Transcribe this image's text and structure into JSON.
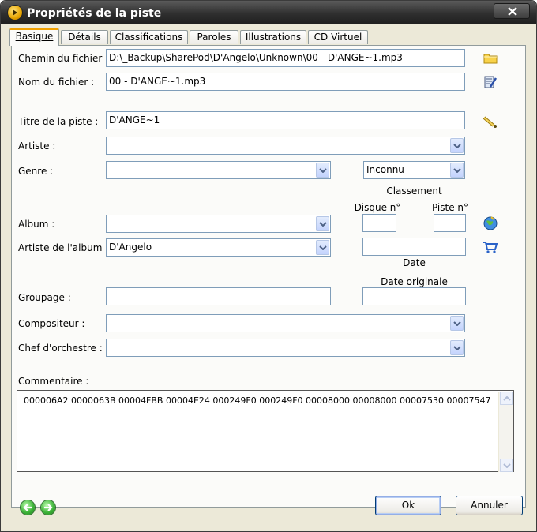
{
  "window": {
    "title": "Propriétés de la piste",
    "close_label": "x"
  },
  "tabs": [
    {
      "label": "Basique",
      "active": true
    },
    {
      "label": "Détails"
    },
    {
      "label": "Classifications"
    },
    {
      "label": "Paroles"
    },
    {
      "label": "Illustrations"
    },
    {
      "label": "CD Virtuel"
    }
  ],
  "form": {
    "file_path_label": "Chemin du fichier :",
    "file_path_value": "D:\\_Backup\\SharePod\\D'Angelo\\Unknown\\00 - D'ANGE~1.mp3",
    "file_name_label": "Nom du fichier :",
    "file_name_value": "00 - D'ANGE~1.mp3",
    "track_title_label": "Titre de la piste :",
    "track_title_value": "D'ANGE~1",
    "artist_label": "Artiste :",
    "artist_value": "",
    "genre_label": "Genre :",
    "genre_value": "",
    "rating_value": "Inconnu",
    "rating_label": "Classement",
    "disc_label": "Disque n°",
    "disc_value": "",
    "track_no_label": "Piste n°",
    "track_no_value": "",
    "album_label": "Album :",
    "album_value": "",
    "album_artist_label": "Artiste de l'album :",
    "album_artist_value": "D'Angelo",
    "date_value": "",
    "date_label": "Date",
    "original_date_label": "Date originale",
    "original_date_value": "",
    "grouping_label": "Groupage :",
    "grouping_value": "",
    "composer_label": "Compositeur :",
    "composer_value": "",
    "conductor_label": "Chef d'orchestre :",
    "conductor_value": "",
    "comment_label": "Commentaire :",
    "comment_value": "000006A2 0000063B 00004FBB 00004E24 000249F0 000249F0 00008000 00008000 00007530 00007547"
  },
  "buttons": {
    "ok": "Ok",
    "cancel": "Annuler"
  },
  "icons": {
    "browse": "folder-icon",
    "rename": "rename-icon",
    "autotag": "magic-wand-icon",
    "web_lookup": "globe-icon",
    "store": "shopping-cart-icon",
    "prev": "previous-arrow-icon",
    "next": "next-arrow-icon"
  },
  "colors": {
    "titlebar": "#2f2f2f",
    "active_tab_accent": "#f0a000",
    "field_border": "#7f9db9",
    "button_border": "#003c74"
  }
}
